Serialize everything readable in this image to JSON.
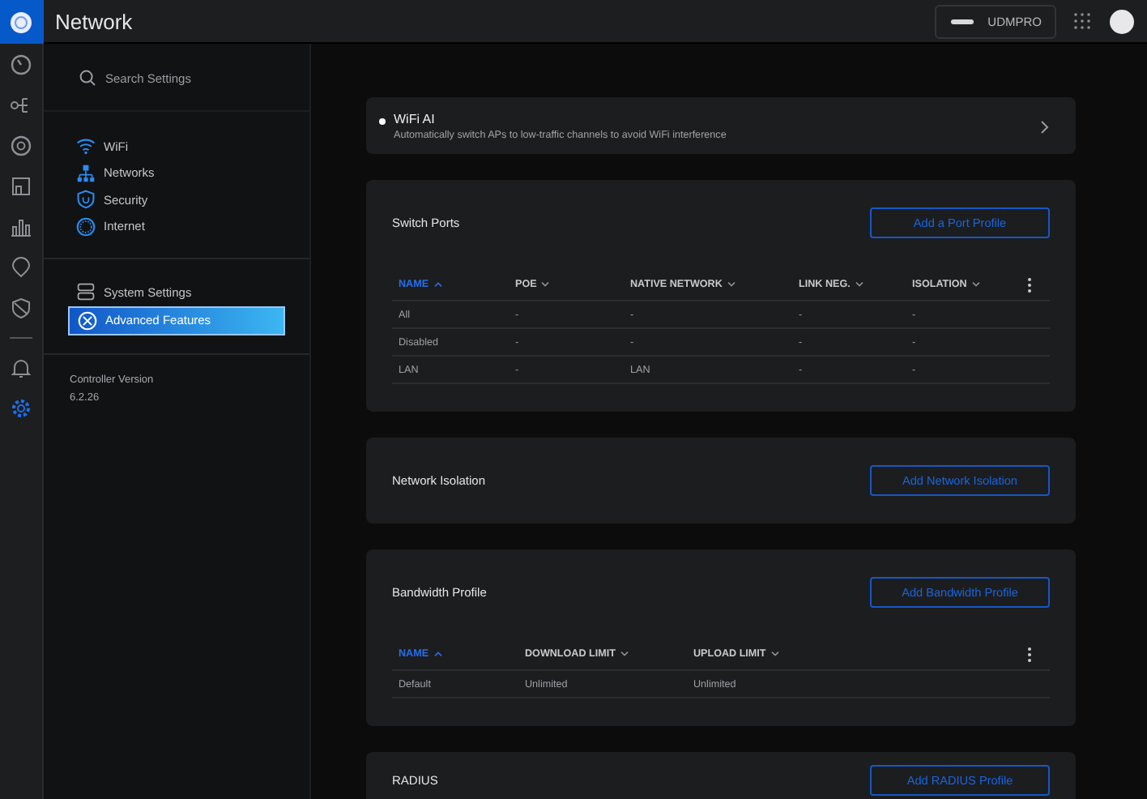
{
  "app": {
    "title": "Network"
  },
  "device": {
    "name": "UDMPRO"
  },
  "rail": {
    "items": [
      {
        "selected": false
      },
      {
        "selected": false
      },
      {
        "selected": false
      },
      {
        "selected": false
      },
      {
        "selected": false
      },
      {
        "selected": false
      },
      {
        "selected": false
      },
      {
        "selected": false
      },
      {
        "selected": true
      }
    ]
  },
  "sidebar": {
    "search": {
      "placeholder": "Search Settings"
    },
    "groups": [
      {
        "items": [
          {
            "label": "WiFi",
            "selected": false
          },
          {
            "label": "Networks",
            "selected": false
          },
          {
            "label": "Security",
            "selected": false
          },
          {
            "label": "Internet",
            "selected": false
          }
        ]
      },
      {
        "items": [
          {
            "label": "System Settings",
            "selected": false
          },
          {
            "label": "Advanced Features",
            "selected": true
          }
        ]
      }
    ],
    "version_label": "Controller Version",
    "version": "6.2.26"
  },
  "cards": [
    {
      "kind": "feature",
      "title": "WiFi AI",
      "description": "Automatically switch APs to low-traffic channels to avoid WiFi interference"
    },
    {
      "kind": "section",
      "title": "Switch Ports",
      "button": "Add a Port Profile",
      "table": {
        "columns": [
          {
            "label": "NAME",
            "sorted": true
          },
          {
            "label": "POE",
            "sorted": false
          },
          {
            "label": "NATIVE NETWORK",
            "sorted": false
          },
          {
            "label": "LINK NEG.",
            "sorted": false
          },
          {
            "label": "ISOLATION",
            "sorted": false
          }
        ],
        "rows": [
          [
            "All",
            "-",
            "-",
            "-",
            "-"
          ],
          [
            "Disabled",
            "-",
            "-",
            "-",
            "-"
          ],
          [
            "LAN",
            "-",
            "LAN",
            "-",
            "-"
          ]
        ]
      }
    },
    {
      "kind": "section",
      "title": "Network Isolation",
      "button": "Add Network Isolation"
    },
    {
      "kind": "section",
      "title": "Bandwidth Profile",
      "button": "Add Bandwidth Profile",
      "table": {
        "columns": [
          {
            "label": "NAME",
            "sorted": true
          },
          {
            "label": "DOWNLOAD LIMIT",
            "sorted": false
          },
          {
            "label": "UPLOAD LIMIT",
            "sorted": false
          }
        ],
        "rows": [
          [
            "Default",
            "Unlimited",
            "Unlimited"
          ]
        ]
      }
    },
    {
      "kind": "section",
      "title": "RADIUS",
      "button": "Add RADIUS Profile"
    }
  ]
}
